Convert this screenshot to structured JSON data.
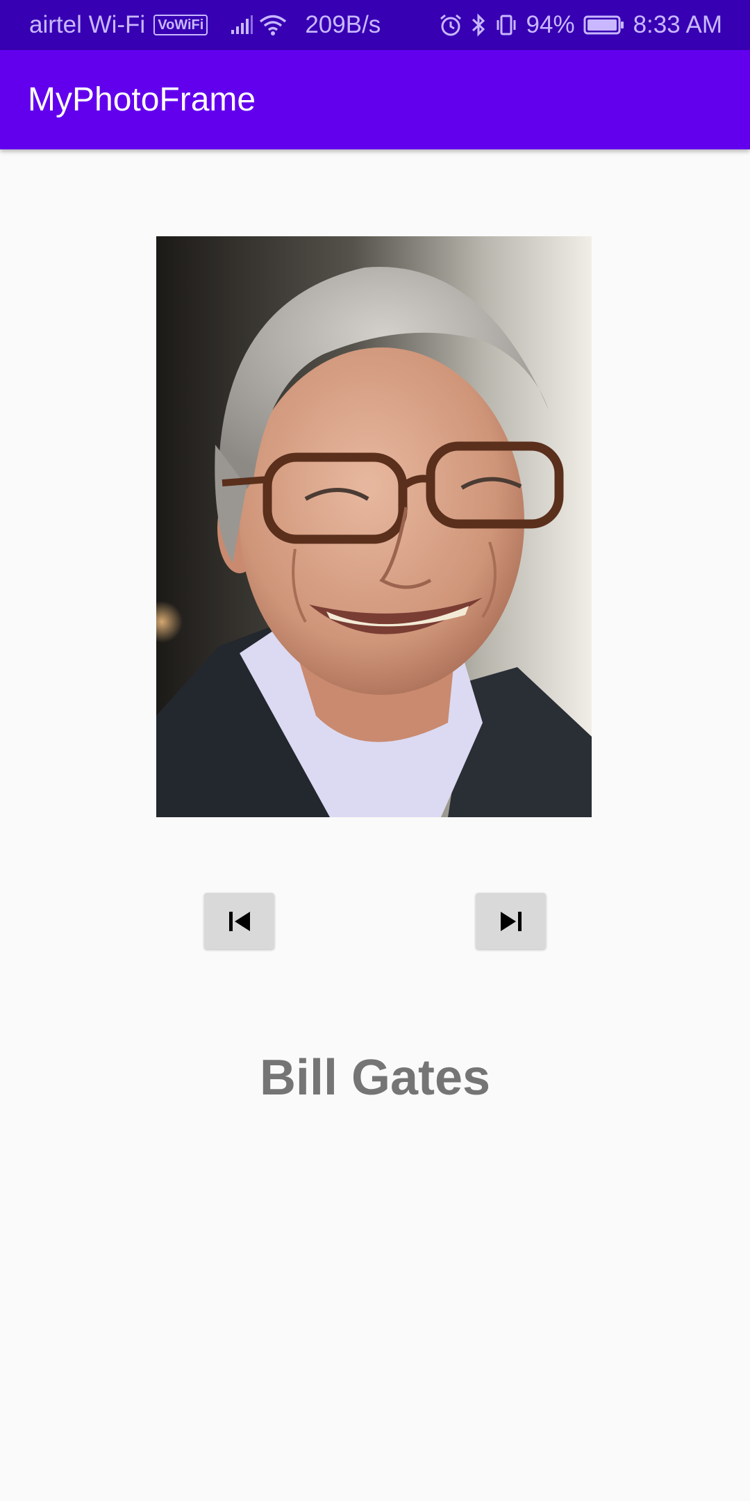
{
  "status_bar": {
    "carrier": "airtel Wi-Fi",
    "volte_badge": "VoWiFi",
    "network_speed": "209B/s",
    "battery_percent": "94%",
    "time": "8:33 AM",
    "icons": [
      "signal-icon",
      "wifi-icon",
      "alarm-icon",
      "bluetooth-icon",
      "vibrate-icon",
      "battery-icon"
    ]
  },
  "app_bar": {
    "title": "MyPhotoFrame",
    "color": "#6200ee"
  },
  "photo": {
    "icons": [
      "portrait-photo"
    ]
  },
  "controls": {
    "previous_icon": "skip-previous-icon",
    "next_icon": "skip-next-icon"
  },
  "caption": {
    "name": "Bill Gates",
    "color": "#757575"
  }
}
